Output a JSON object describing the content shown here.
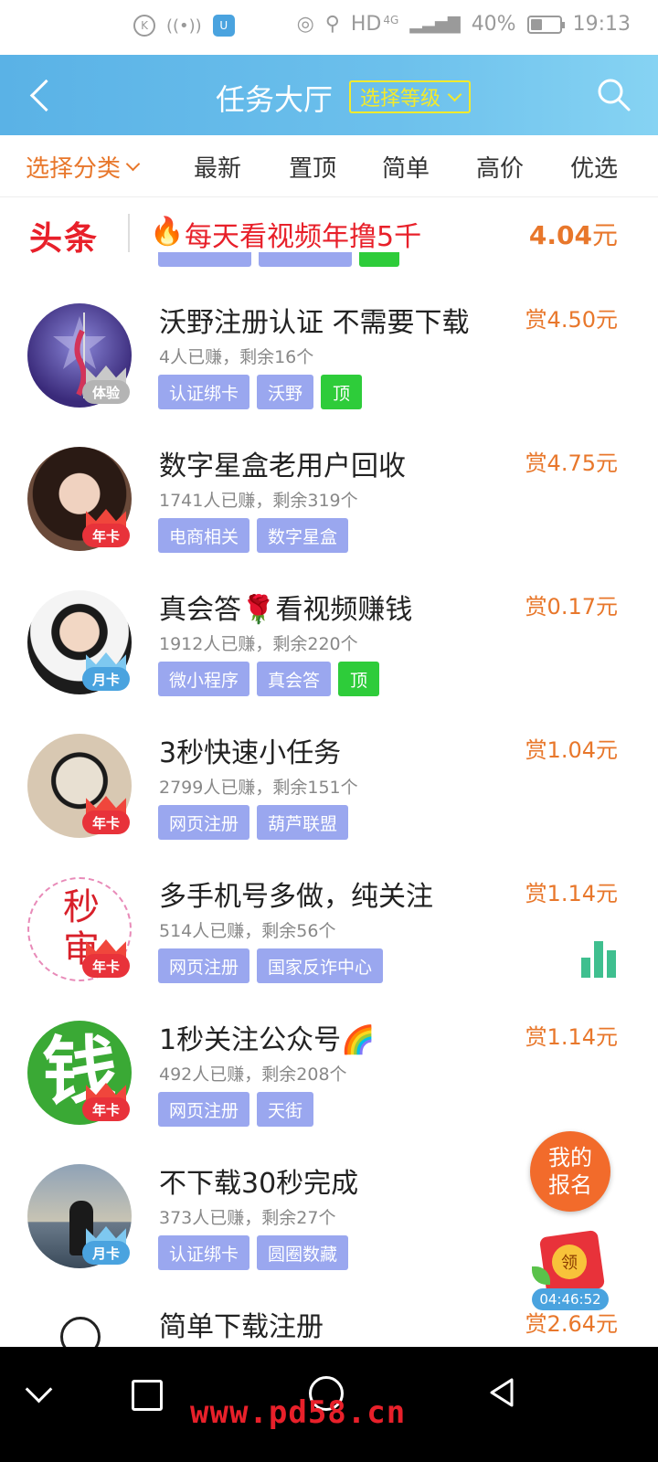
{
  "status_bar": {
    "left_icons": [
      "k-circle-icon",
      "nfc-signal-icon",
      "shield-app-icon"
    ],
    "network": "HD",
    "net_type": "4G",
    "battery_text": "40%",
    "battery_level": 0.4,
    "time": "19:13"
  },
  "header": {
    "title": "任务大厅",
    "level_button": "选择等级",
    "accent": "#5ab2e6"
  },
  "categories": {
    "select_label": "选择分类",
    "items": [
      "最新",
      "置顶",
      "简单",
      "高价",
      "优选"
    ]
  },
  "ticker": {
    "logo": "头条",
    "text": "每天看视频年撸5千",
    "amount": "4.04",
    "currency": "元"
  },
  "tasks": [
    {
      "title": "沃野注册认证 不需要下载",
      "reward": "赏4.50元",
      "stats": "4人已赚，剩余16个",
      "tags": [
        "认证绑卡",
        "沃野"
      ],
      "pinned": true,
      "badge": "体验"
    },
    {
      "title": "数字星盒老用户回收",
      "reward": "赏4.75元",
      "stats": "1741人已赚，剩余319个",
      "tags": [
        "电商相关",
        "数字星盒"
      ],
      "pinned": false,
      "badge": "年卡"
    },
    {
      "title": "真会答🌹看视频赚钱",
      "reward": "赏0.17元",
      "stats": "1912人已赚，剩余220个",
      "tags": [
        "微小程序",
        "真会答"
      ],
      "pinned": true,
      "badge": "月卡"
    },
    {
      "title": "3秒快速小任务",
      "reward": "赏1.04元",
      "stats": "2799人已赚，剩余151个",
      "tags": [
        "网页注册",
        "葫芦联盟"
      ],
      "pinned": false,
      "badge": "年卡"
    },
    {
      "title": "多手机号多做，纯关注",
      "reward": "赏1.14元",
      "stats": "514人已赚，剩余56个",
      "tags": [
        "网页注册",
        "国家反诈中心"
      ],
      "pinned": false,
      "badge": "年卡",
      "avatar_text": "秒审"
    },
    {
      "title": "1秒关注公众号🌈",
      "reward": "赏1.14元",
      "stats": "492人已赚，剩余208个",
      "tags": [
        "网页注册",
        "天街"
      ],
      "pinned": false,
      "badge": "年卡",
      "avatar_text": "钱"
    },
    {
      "title": "不下载30秒完成",
      "reward": "",
      "stats": "373人已赚，剩余27个",
      "tags": [
        "认证绑卡",
        "圆圈数藏"
      ],
      "pinned": false,
      "badge": "月卡"
    },
    {
      "title": "简单下载注册",
      "reward": "赏2.64元",
      "stats": "",
      "tags": [],
      "pinned": false,
      "badge": ""
    }
  ],
  "pin_label": "顶",
  "floating": {
    "my_signup_line1": "我的",
    "my_signup_line2": "报名",
    "redpack_label": "领",
    "countdown": "04:46:52"
  },
  "watermark": "www.pd58.cn",
  "colors": {
    "orange": "#e8772b",
    "tag_blue": "#9aa7ef",
    "pin_green": "#2ecc3a",
    "red": "#e8202a"
  }
}
